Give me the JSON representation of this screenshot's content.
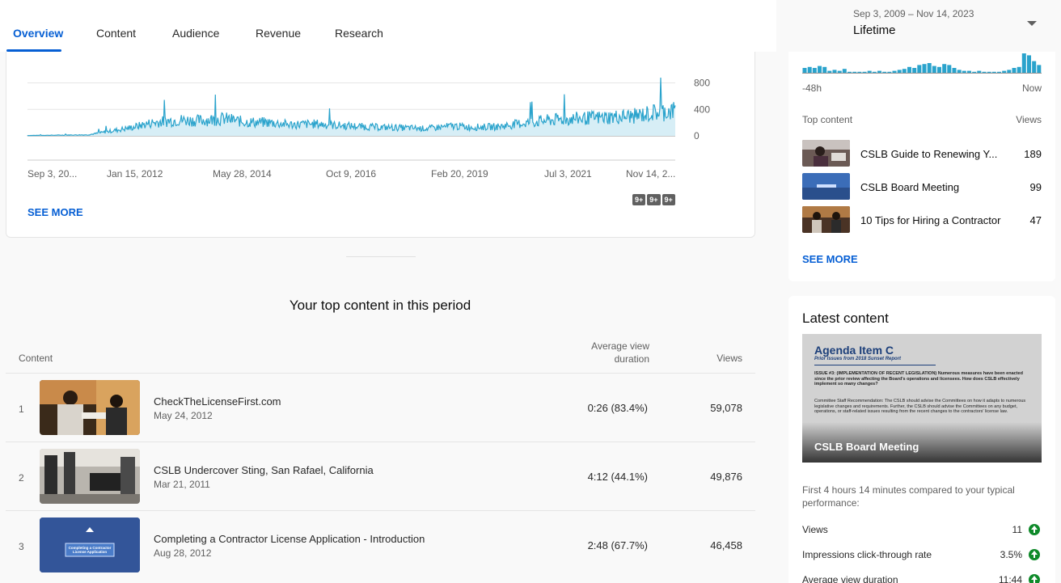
{
  "tabs": [
    {
      "label": "Overview",
      "active": true
    },
    {
      "label": "Content",
      "active": false
    },
    {
      "label": "Audience",
      "active": false
    },
    {
      "label": "Revenue",
      "active": false
    },
    {
      "label": "Research",
      "active": false
    }
  ],
  "date_range": {
    "range": "Sep 3, 2009 – Nov 14, 2023",
    "label": "Lifetime"
  },
  "chart_data": {
    "type": "area",
    "metric": "Views",
    "color": "#2aa3cc",
    "y_ticks": [
      "800",
      "400",
      "0"
    ],
    "ylim": [
      0,
      880
    ],
    "x_tick_labels": [
      "Sep 3, 20...",
      "Jan 15, 2012",
      "May 28, 2014",
      "Oct 9, 2016",
      "Feb 20, 2019",
      "Jul 3, 2021",
      "Nov 14, 2..."
    ],
    "x_range": [
      "2009-09-03",
      "2023-11-14"
    ],
    "series": [
      {
        "x": [
          "2009-09-03",
          "2011-01-01",
          "2011-12-01",
          "2012-06-01",
          "2013-01-01",
          "2013-06-01",
          "2014-01-01",
          "2014-06-01",
          "2015-01-01",
          "2015-06-01",
          "2016-01-01",
          "2016-06-01",
          "2017-01-01",
          "2017-06-01",
          "2018-01-01",
          "2018-06-01",
          "2019-01-01",
          "2019-06-01",
          "2020-01-01",
          "2020-06-01",
          "2021-01-01",
          "2021-06-01",
          "2022-01-01",
          "2022-06-01",
          "2023-01-01",
          "2023-06-01",
          "2023-11-01"
        ],
        "y": [
          5,
          15,
          120,
          200,
          240,
          230,
          260,
          210,
          200,
          170,
          180,
          160,
          140,
          130,
          120,
          110,
          150,
          130,
          140,
          180,
          230,
          250,
          270,
          280,
          300,
          350,
          380
        ]
      }
    ],
    "annotations": [
      "9+",
      "9+",
      "9+"
    ]
  },
  "chart_see_more": "SEE MORE",
  "top_content": {
    "title": "Your top content in this period",
    "columns": {
      "content": "Content",
      "avd": "Average view duration",
      "views": "Views"
    },
    "rows": [
      {
        "rank": "1",
        "title": "CheckTheLicenseFirst.com",
        "date": "May 24, 2012",
        "avd": "0:26  (83.4%)",
        "views": "59,078"
      },
      {
        "rank": "2",
        "title": "CSLB Undercover Sting, San Rafael, California",
        "date": "Mar 21, 2011",
        "avd": "4:12  (44.1%)",
        "views": "49,876"
      },
      {
        "rank": "3",
        "title": "Completing a Contractor License Application - Introduction",
        "date": "Aug 28, 2012",
        "avd": "2:48  (67.7%)",
        "views": "46,458"
      }
    ],
    "thumb3_text": "Completing a Contractor License Application"
  },
  "realtime": {
    "axis_left": "-48h",
    "axis_right": "Now",
    "header_left": "Top content",
    "header_right": "Views",
    "bars": [
      5,
      6,
      5,
      7,
      6,
      2,
      3,
      2,
      4,
      1,
      1,
      1,
      1,
      2,
      1,
      2,
      1,
      1,
      2,
      3,
      4,
      6,
      5,
      8,
      9,
      10,
      7,
      6,
      9,
      8,
      5,
      3,
      2,
      2,
      1,
      2,
      1,
      1,
      1,
      1,
      2,
      3,
      5,
      6,
      20,
      18,
      12,
      8
    ],
    "items": [
      {
        "title": "CSLB Guide to Renewing Y...",
        "views": "189"
      },
      {
        "title": "CSLB Board Meeting",
        "views": "99"
      },
      {
        "title": "10 Tips for Hiring a Contractor",
        "views": "47"
      }
    ],
    "see_more": "SEE MORE"
  },
  "latest": {
    "title": "Latest content",
    "thumb_heading": "Agenda Item C",
    "thumb_sub": "Prior Issues from 2018 Sunset Report",
    "thumb_p1": "ISSUE #3: (IMPLEMENTATION OF RECENT LEGISLATION) Numerous measures have been enacted since the prior review affecting the Board's operations and licensees. How does CSLB effectively implement so many changes?",
    "thumb_p2": "Committee Staff Recommendation: The CSLB should advise the Committees on how it adapts to numerous legislative changes and requirements. Further, the CSLB should advise the Committees on any budget, operations, or staff-related issues resulting from the recent changes to the contractors' license law.",
    "video_title": "CSLB Board Meeting",
    "description": "First 4 hours 14 minutes compared to your typical performance:",
    "metrics": [
      {
        "label": "Views",
        "value": "11"
      },
      {
        "label": "Impressions click-through rate",
        "value": "3.5%"
      },
      {
        "label": "Average view duration",
        "value": "11:44"
      }
    ]
  }
}
